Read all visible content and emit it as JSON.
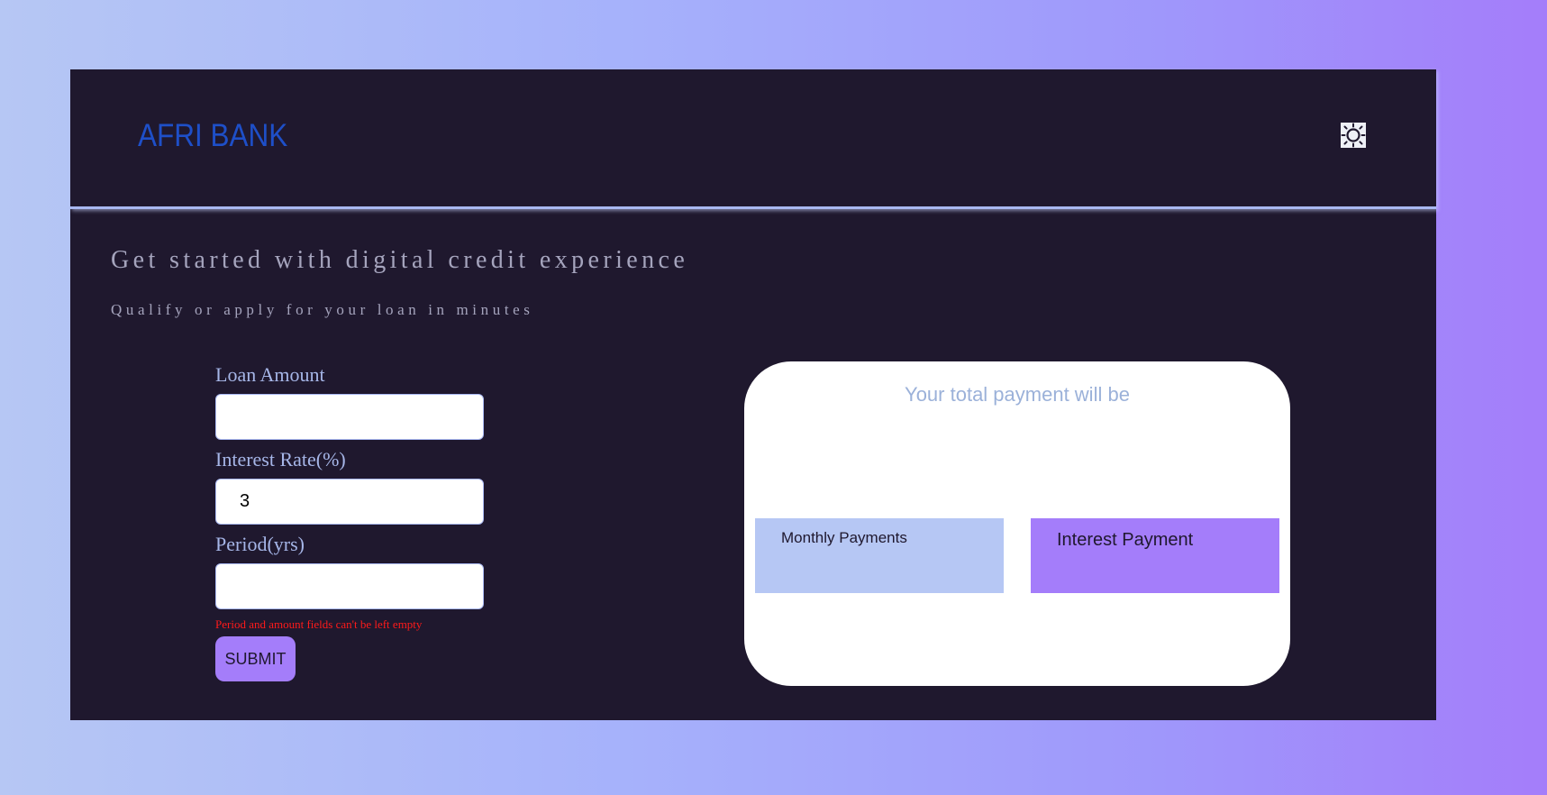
{
  "header": {
    "brand": "AFRI BANK",
    "theme_toggle_icon": "sun-icon"
  },
  "hero": {
    "title": "Get started with digital credit experience",
    "subtitle": "Qualify or apply for your loan in minutes"
  },
  "form": {
    "loan_amount": {
      "label": "Loan Amount",
      "value": ""
    },
    "interest_rate": {
      "label": "Interest Rate(%)",
      "value": "3"
    },
    "period": {
      "label": "Period(yrs)",
      "value": ""
    },
    "error": "Period and amount fields can't be left empty",
    "submit_label": "SUBMIT"
  },
  "result": {
    "title": "Your total payment will be",
    "monthly_label": "Monthly Payments",
    "interest_label": "Interest Payment"
  },
  "colors": {
    "brand": "#1e4fc8",
    "panel_background": "#1f182e",
    "accent_purple": "#a47dfa",
    "accent_blue": "#b6c7f4",
    "error": "#ff1a1a"
  }
}
